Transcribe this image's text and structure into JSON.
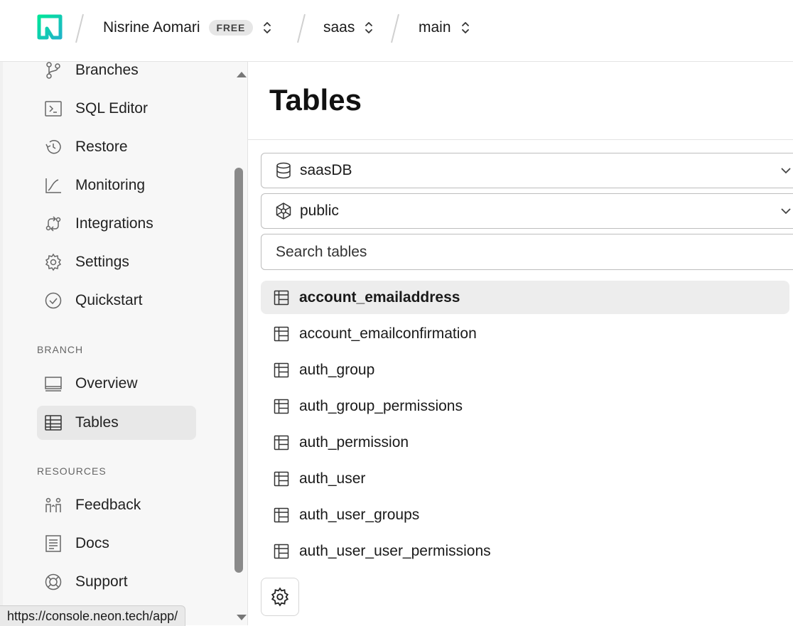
{
  "topbar": {
    "user_name": "Nisrine Aomari",
    "plan_badge": "FREE",
    "project": "saas",
    "branch": "main"
  },
  "sidebar": {
    "items": [
      {
        "label": "Branches",
        "icon": "branch-icon"
      },
      {
        "label": "SQL Editor",
        "icon": "terminal-icon"
      },
      {
        "label": "Restore",
        "icon": "restore-clock-icon"
      },
      {
        "label": "Monitoring",
        "icon": "chart-line-icon"
      },
      {
        "label": "Integrations",
        "icon": "integrations-icon"
      },
      {
        "label": "Settings",
        "icon": "gear-icon"
      },
      {
        "label": "Quickstart",
        "icon": "check-circle-icon"
      }
    ],
    "branch_section": {
      "label": "BRANCH",
      "items": [
        {
          "label": "Overview",
          "icon": "monitor-icon"
        },
        {
          "label": "Tables",
          "icon": "table-icon",
          "active": true
        }
      ]
    },
    "resources_section": {
      "label": "RESOURCES",
      "items": [
        {
          "label": "Feedback",
          "icon": "people-icon"
        },
        {
          "label": "Docs",
          "icon": "document-icon"
        },
        {
          "label": "Support",
          "icon": "lifebuoy-icon"
        }
      ]
    }
  },
  "status_bar": {
    "url": "https://console.neon.tech/app/"
  },
  "main": {
    "title": "Tables",
    "database_select": "saasDB",
    "schema_select": "public",
    "search_placeholder": "Search tables",
    "tables": [
      "account_emailaddress",
      "account_emailconfirmation",
      "auth_group",
      "auth_group_permissions",
      "auth_permission",
      "auth_user",
      "auth_user_groups",
      "auth_user_user_permissions"
    ],
    "selected_table": "account_emailaddress"
  },
  "colors": {
    "brand_green": "#00e599",
    "brand_teal": "#1fb4c8",
    "sidebar_bg": "#f7f7f7",
    "active_bg": "#e8e8e8"
  }
}
